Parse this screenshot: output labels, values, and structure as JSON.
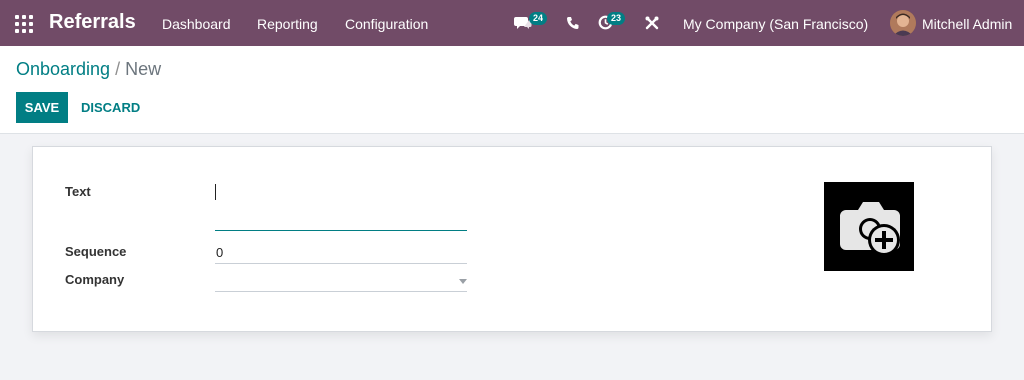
{
  "navbar": {
    "app_name": "Referrals",
    "menu": [
      "Dashboard",
      "Reporting",
      "Configuration"
    ],
    "messages_count": "24",
    "activities_count": "23",
    "company": "My Company (San Francisco)",
    "user": "Mitchell Admin"
  },
  "breadcrumb": {
    "parent": "Onboarding",
    "separator": " / ",
    "current": "New"
  },
  "buttons": {
    "save": "SAVE",
    "discard": "DISCARD"
  },
  "form": {
    "text_label": "Text",
    "text_value": "",
    "sequence_label": "Sequence",
    "sequence_value": "0",
    "company_label": "Company",
    "company_value": ""
  },
  "colors": {
    "navbar": "#714b67",
    "accent": "#017e84",
    "background": "#f2f3f6"
  },
  "icons": [
    "apps-grid-icon",
    "chat-icon",
    "phone-icon",
    "activity-clock-icon",
    "tools-icon",
    "camera-plus-icon"
  ]
}
